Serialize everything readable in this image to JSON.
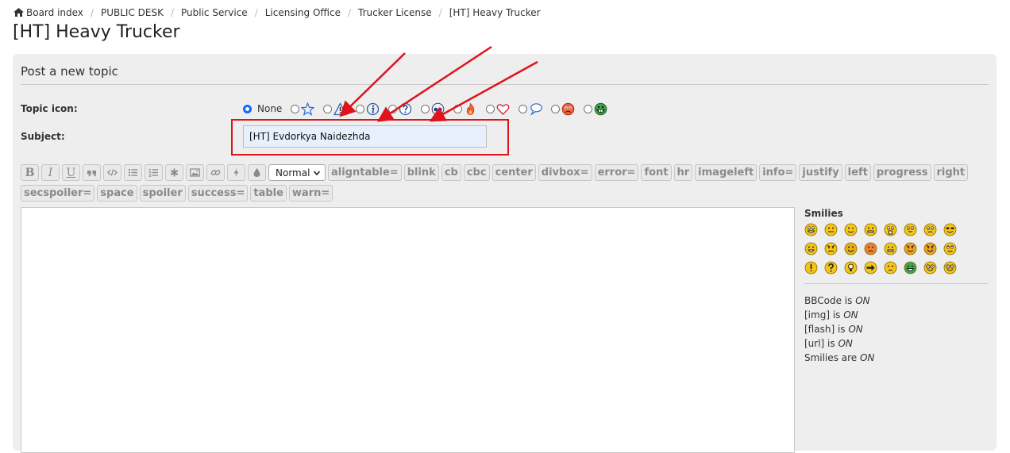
{
  "breadcrumb": [
    "Board index",
    "PUBLIC DESK",
    "Public Service",
    "Licensing Office",
    "Trucker License",
    "[HT] Heavy Trucker"
  ],
  "page_title": "[HT] Heavy Trucker",
  "panel_title": "Post a new topic",
  "topic_icon": {
    "label": "Topic icon:",
    "none_label": "None",
    "icons": [
      "star-icon",
      "warning-icon",
      "info-icon",
      "question-icon",
      "eyes-icon",
      "fire-icon",
      "heart-icon",
      "speech-bubble-icon",
      "sad-face-icon",
      "grin-face-icon"
    ]
  },
  "subject": {
    "label": "Subject:",
    "value": "[HT] Evdorkya Naidezhda"
  },
  "toolbar": {
    "format_buttons": [
      "bold-icon",
      "italic-icon",
      "underline-icon",
      "quote-icon",
      "code-icon",
      "list-icon",
      "numbered-list-icon",
      "asterisk-icon",
      "image-icon",
      "link-icon",
      "flash-icon",
      "color-drop-icon"
    ],
    "size_select": "Normal",
    "tags": [
      "aligntable=",
      "blink",
      "cb",
      "cbc",
      "center",
      "divbox=",
      "error=",
      "font",
      "hr",
      "imageleft",
      "info=",
      "justify",
      "left",
      "progress",
      "right",
      "secspoiler=",
      "space",
      "spoiler",
      "success=",
      "table",
      "warn="
    ]
  },
  "smilies_title": "Smilies",
  "status": [
    {
      "prefix": "BBCode is ",
      "state": "ON"
    },
    {
      "prefix": "[img] is ",
      "state": "ON"
    },
    {
      "prefix": "[flash] is ",
      "state": "ON"
    },
    {
      "prefix": "[url] is ",
      "state": "ON"
    },
    {
      "prefix": "Smilies are ",
      "state": "ON"
    }
  ],
  "colors": {
    "accent": "#0a6cff",
    "annotation_red": "#e0121a",
    "smiley_yellow": "#f5c518"
  }
}
